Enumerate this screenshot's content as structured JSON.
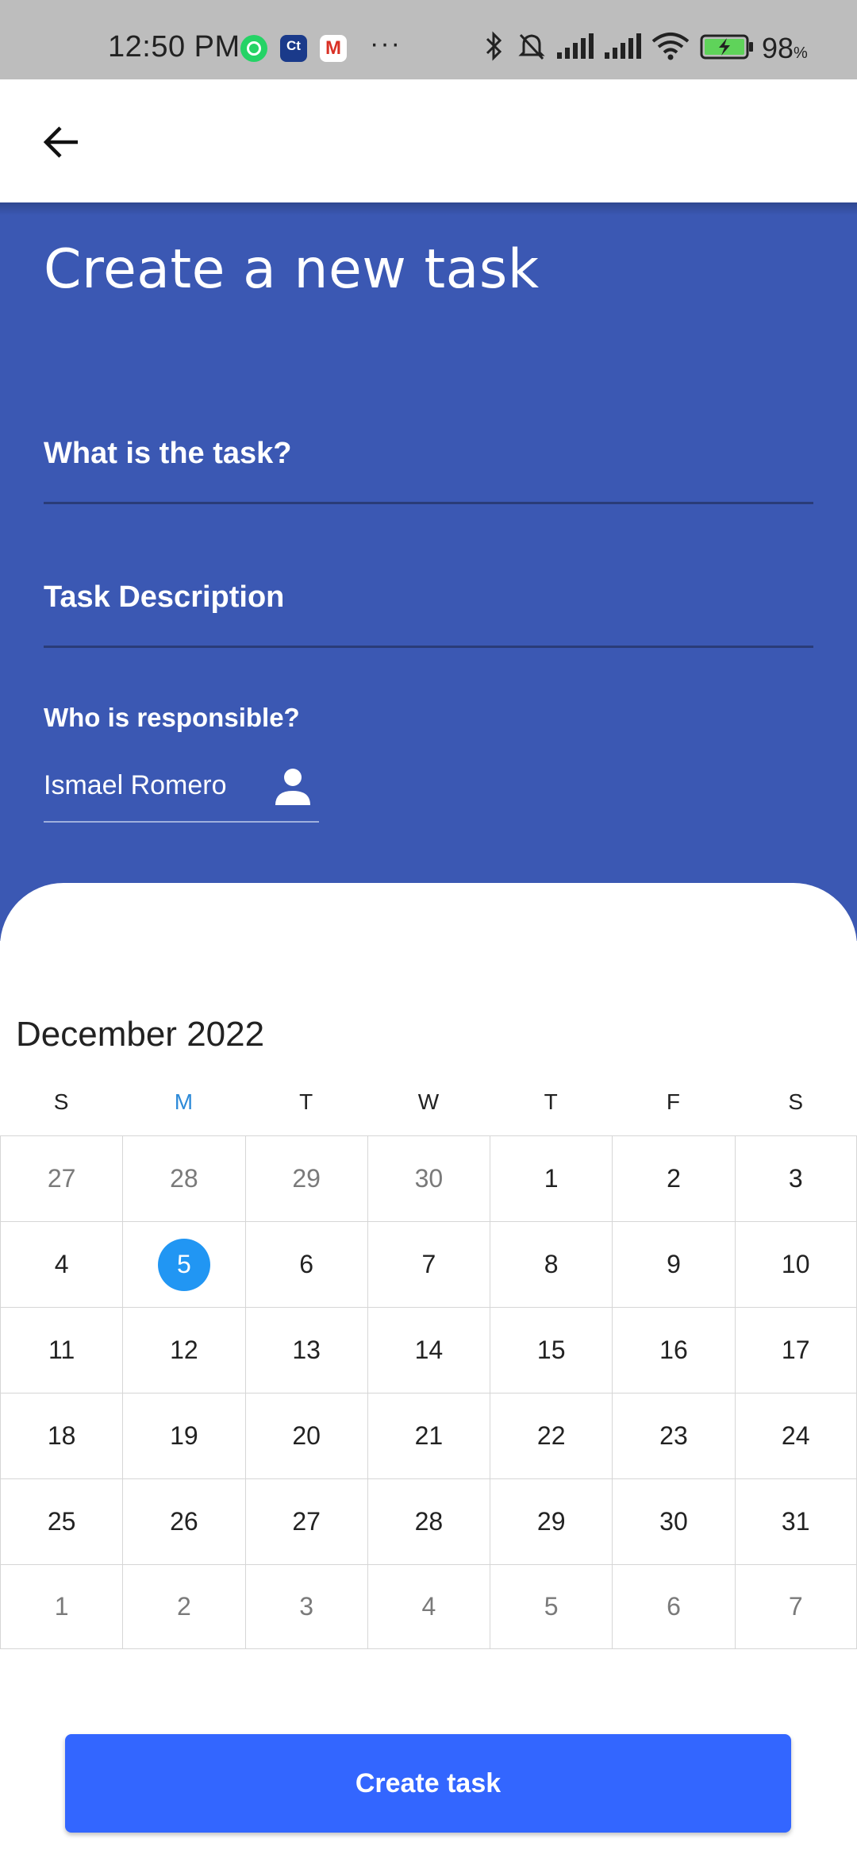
{
  "status_bar": {
    "time": "12:50 PM",
    "more": "···",
    "battery_pct": "98",
    "battery_unit": "%",
    "icons": [
      "whatsapp-icon",
      "ct-app-icon",
      "gmail-icon",
      "more-icon",
      "bluetooth-icon",
      "mute-icon",
      "signal-icon",
      "signal-icon",
      "wifi-icon",
      "battery-charging-icon"
    ]
  },
  "app_bar": {
    "back_icon": "arrow-left-icon"
  },
  "form": {
    "title": "Create a new task",
    "task_placeholder": "What is the task?",
    "description_placeholder": "Task Description",
    "responsible_label": "Who is responsible?",
    "responsible_value": "Ismael Romero",
    "responsible_icon": "person-icon"
  },
  "calendar": {
    "month_label": "December 2022",
    "weekdays": [
      "S",
      "M",
      "T",
      "W",
      "T",
      "F",
      "S"
    ],
    "today_weekday_index": 1,
    "selected_day": "5",
    "weeks": [
      [
        {
          "d": "27",
          "m": true
        },
        {
          "d": "28",
          "m": true
        },
        {
          "d": "29",
          "m": true
        },
        {
          "d": "30",
          "m": true
        },
        {
          "d": "1"
        },
        {
          "d": "2"
        },
        {
          "d": "3"
        }
      ],
      [
        {
          "d": "4"
        },
        {
          "d": "5",
          "s": true
        },
        {
          "d": "6"
        },
        {
          "d": "7"
        },
        {
          "d": "8"
        },
        {
          "d": "9"
        },
        {
          "d": "10"
        }
      ],
      [
        {
          "d": "11"
        },
        {
          "d": "12"
        },
        {
          "d": "13"
        },
        {
          "d": "14"
        },
        {
          "d": "15"
        },
        {
          "d": "16"
        },
        {
          "d": "17"
        }
      ],
      [
        {
          "d": "18"
        },
        {
          "d": "19"
        },
        {
          "d": "20"
        },
        {
          "d": "21"
        },
        {
          "d": "22"
        },
        {
          "d": "23"
        },
        {
          "d": "24"
        }
      ],
      [
        {
          "d": "25"
        },
        {
          "d": "26"
        },
        {
          "d": "27"
        },
        {
          "d": "28"
        },
        {
          "d": "29"
        },
        {
          "d": "30"
        },
        {
          "d": "31"
        }
      ],
      [
        {
          "d": "1",
          "m": true
        },
        {
          "d": "2",
          "m": true
        },
        {
          "d": "3",
          "m": true
        },
        {
          "d": "4",
          "m": true
        },
        {
          "d": "5",
          "m": true
        },
        {
          "d": "6",
          "m": true
        },
        {
          "d": "7",
          "m": true
        }
      ]
    ]
  },
  "actions": {
    "create_label": "Create task"
  },
  "colors": {
    "header_blue": "#3b58b3",
    "button_blue": "#3366ff",
    "selected_day": "#2196f3",
    "today_weekday": "#2d8ad8"
  }
}
